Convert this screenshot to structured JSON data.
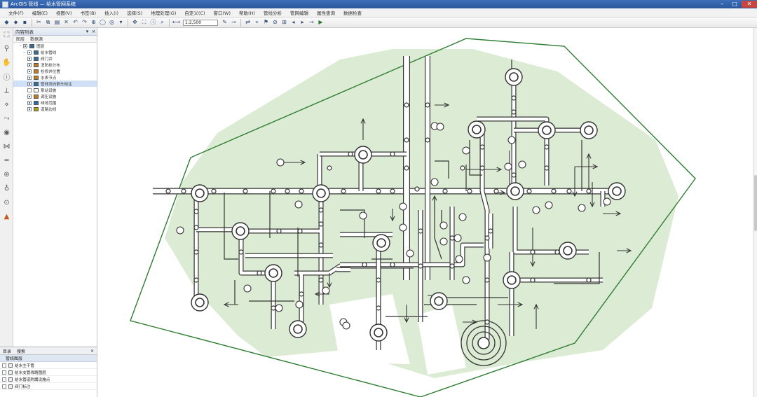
{
  "window": {
    "title": "ArcGIS 管线 — 给水管网系统",
    "minimize": "–",
    "maximize": "□",
    "close": "✕"
  },
  "menu": [
    "文件(F)",
    "编辑(E)",
    "视图(V)",
    "书签(B)",
    "插入(I)",
    "选择(S)",
    "地理处理(G)",
    "自定义(C)",
    "窗口(W)",
    "帮助(H)",
    "管线分析",
    "管网编辑",
    "属性查询",
    "数据检查"
  ],
  "toolbar": {
    "scale": "1:2,500",
    "tools": [
      "new-icon",
      "open-icon",
      "save-icon",
      "print-icon",
      "cut-icon",
      "copy-icon",
      "paste-icon",
      "delete-icon",
      "undo-icon",
      "redo-icon",
      "add-data-icon",
      "zoom-in-icon",
      "zoom-out-icon",
      "pan-icon",
      "full-extent-icon",
      "identify-icon",
      "find-icon",
      "measure-icon",
      "editor-icon",
      "sketch-icon",
      "flow-icon",
      "trace-icon",
      "flag-icon",
      "barrier-icon",
      "solve-icon"
    ]
  },
  "layer_panel": {
    "title": "内容列表",
    "columns": [
      "图层",
      "数据源"
    ],
    "layers": [
      {
        "label": "图层",
        "indent": 1,
        "expanded": true,
        "checked": true,
        "color": "#2f6d9e"
      },
      {
        "label": "给水管线",
        "indent": 2,
        "expanded": true,
        "checked": true,
        "color": "#2f6d9e"
      },
      {
        "label": "阀门井",
        "indent": 2,
        "expanded": false,
        "checked": true,
        "color": "#2f6d9e"
      },
      {
        "label": "消防栓分布",
        "indent": 2,
        "expanded": false,
        "checked": true,
        "color": "#c07a1d"
      },
      {
        "label": "检修井位置",
        "indent": 2,
        "expanded": false,
        "checked": true,
        "color": "#c07a1d"
      },
      {
        "label": "水表节点",
        "indent": 2,
        "expanded": false,
        "checked": true,
        "color": "#c07a1d"
      },
      {
        "label": "管线流向箭头标注",
        "indent": 2,
        "expanded": false,
        "checked": true,
        "color": "#2f6d9e",
        "selected": true
      },
      {
        "label": "泵站设施",
        "indent": 2,
        "expanded": false,
        "checked": false,
        "color": "#ffffff"
      },
      {
        "label": "调压设施",
        "indent": 2,
        "expanded": false,
        "checked": true,
        "color": "#c07a1d"
      },
      {
        "label": "绿地范围",
        "indent": 2,
        "expanded": false,
        "checked": true,
        "color": "#2f6d9e"
      },
      {
        "label": "道路边线",
        "indent": 2,
        "expanded": false,
        "checked": true,
        "color": "#b0a000"
      }
    ]
  },
  "left_icons": [
    "select-icon",
    "zoom-icon",
    "pan-tool-icon",
    "info-icon",
    "measure-tool-icon",
    "edit-vertex-icon",
    "route-icon",
    "node-icon",
    "valve-icon",
    "pipe-icon",
    "pump-icon",
    "hydrant-icon",
    "meter-icon",
    "warning-icon"
  ],
  "bottom_panel": {
    "tabs": [
      "目录",
      "搜索"
    ],
    "header": "管线图层",
    "items": [
      "给水主干管",
      "给水支管线路图层",
      "给水管道附属设施点",
      "阀门标注"
    ]
  },
  "map": {
    "green_area_color": "#dcebd3",
    "boundary_color": "#2e7d32",
    "pipe_color": "#333333"
  }
}
